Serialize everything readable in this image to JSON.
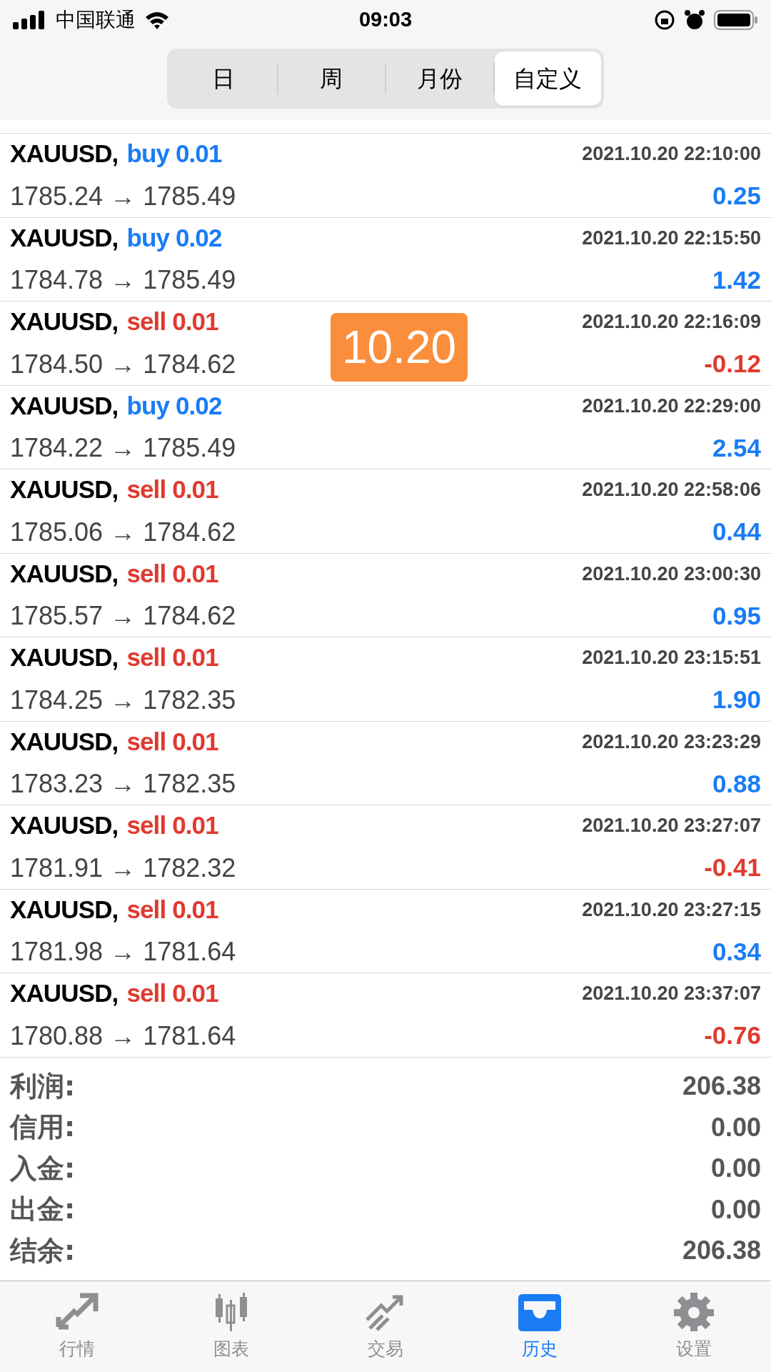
{
  "status_bar": {
    "carrier": "中国联通",
    "time": "09:03"
  },
  "tabs": [
    {
      "label": "日",
      "selected": false
    },
    {
      "label": "周",
      "selected": false
    },
    {
      "label": "月份",
      "selected": false
    },
    {
      "label": "自定义",
      "selected": true
    }
  ],
  "trades": [
    {
      "symbol": "XAUUSD,",
      "side": "buy",
      "kind": "buy",
      "volume": "0.01",
      "time": "2021.10.20 22:10:00",
      "prices": "1785.24 → 1785.49",
      "profit": "0.25",
      "loss": false
    },
    {
      "symbol": "XAUUSD,",
      "side": "buy",
      "kind": "buy",
      "volume": "0.02",
      "time": "2021.10.20 22:15:50",
      "prices": "1784.78 → 1785.49",
      "profit": "1.42",
      "loss": false
    },
    {
      "symbol": "XAUUSD,",
      "side": "sell",
      "kind": "sell",
      "volume": "0.01",
      "time": "2021.10.20 22:16:09",
      "prices": "1784.50 → 1784.62",
      "profit": "-0.12",
      "loss": true
    },
    {
      "symbol": "XAUUSD,",
      "side": "buy",
      "kind": "buy",
      "volume": "0.02",
      "time": "2021.10.20 22:29:00",
      "prices": "1784.22 → 1785.49",
      "profit": "2.54",
      "loss": false
    },
    {
      "symbol": "XAUUSD,",
      "side": "sell",
      "kind": "sell",
      "volume": "0.01",
      "time": "2021.10.20 22:58:06",
      "prices": "1785.06 → 1784.62",
      "profit": "0.44",
      "loss": false
    },
    {
      "symbol": "XAUUSD,",
      "side": "sell",
      "kind": "sell",
      "volume": "0.01",
      "time": "2021.10.20 23:00:30",
      "prices": "1785.57 → 1784.62",
      "profit": "0.95",
      "loss": false
    },
    {
      "symbol": "XAUUSD,",
      "side": "sell",
      "kind": "sell",
      "volume": "0.01",
      "time": "2021.10.20 23:15:51",
      "prices": "1784.25 → 1782.35",
      "profit": "1.90",
      "loss": false
    },
    {
      "symbol": "XAUUSD,",
      "side": "sell",
      "kind": "sell",
      "volume": "0.01",
      "time": "2021.10.20 23:23:29",
      "prices": "1783.23 → 1782.35",
      "profit": "0.88",
      "loss": false
    },
    {
      "symbol": "XAUUSD,",
      "side": "sell",
      "kind": "sell",
      "volume": "0.01",
      "time": "2021.10.20 23:27:07",
      "prices": "1781.91 → 1782.32",
      "profit": "-0.41",
      "loss": true
    },
    {
      "symbol": "XAUUSD,",
      "side": "sell",
      "kind": "sell",
      "volume": "0.01",
      "time": "2021.10.20 23:27:15",
      "prices": "1781.98 → 1781.64",
      "profit": "0.34",
      "loss": false
    },
    {
      "symbol": "XAUUSD,",
      "side": "sell",
      "kind": "sell",
      "volume": "0.01",
      "time": "2021.10.20 23:37:07",
      "prices": "1780.88 → 1781.64",
      "profit": "-0.76",
      "loss": true
    }
  ],
  "date_badge": "10.20",
  "summary": [
    {
      "label": "利润:",
      "value": "206.38"
    },
    {
      "label": "信用:",
      "value": "0.00"
    },
    {
      "label": "入金:",
      "value": "0.00"
    },
    {
      "label": "出金:",
      "value": "0.00"
    },
    {
      "label": "结余:",
      "value": "206.38"
    }
  ],
  "bottom_tabs": [
    {
      "label": "行情",
      "kind": "quotes",
      "selected": false
    },
    {
      "label": "图表",
      "kind": "chart",
      "selected": false
    },
    {
      "label": "交易",
      "kind": "trade",
      "selected": false
    },
    {
      "label": "历史",
      "kind": "history",
      "selected": true
    },
    {
      "label": "设置",
      "kind": "settings",
      "selected": false
    }
  ]
}
